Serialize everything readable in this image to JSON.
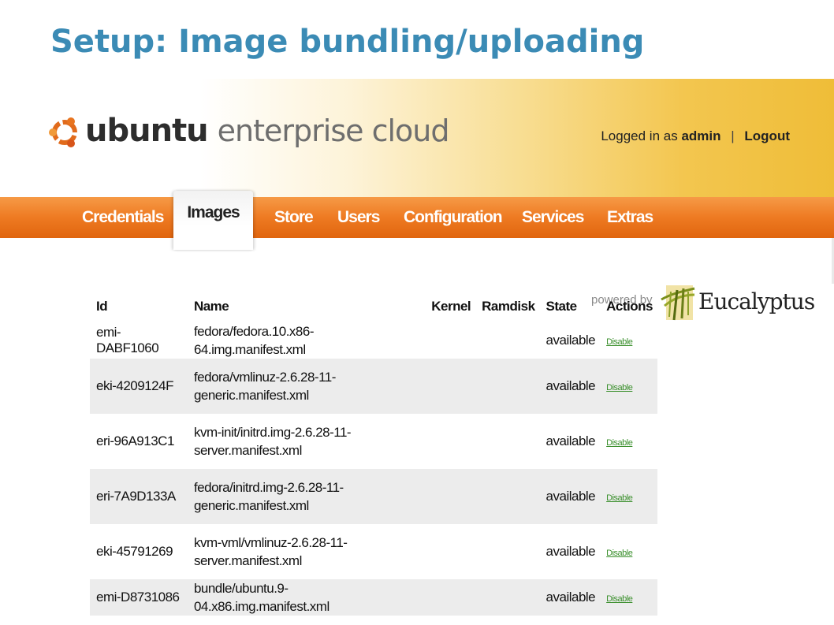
{
  "slide": {
    "title": "Setup: Image bundling/uploading"
  },
  "header": {
    "brand_ubuntu": "ubuntu",
    "brand_rest": "enterprise cloud",
    "login_prefix": "Logged in as",
    "login_user": "admin",
    "login_separator": "|",
    "logout_label": "Logout"
  },
  "nav": {
    "items": [
      "Credentials",
      "Images",
      "Store",
      "Users",
      "Configuration",
      "Services",
      "Extras"
    ],
    "active": "Images"
  },
  "powered_by": {
    "text": "powered by",
    "brand": "Eucalyptus"
  },
  "table": {
    "headers": [
      "Id",
      "Name",
      "Kernel",
      "Ramdisk",
      "State",
      "Actions"
    ],
    "rows": [
      {
        "id": "emi-DABF1060",
        "name_line1": "fedora/fedora.10.x86-64.img.manifest.xml",
        "name_line2": "",
        "kernel": "",
        "ramdisk": "",
        "state": "available",
        "action": "Disable"
      },
      {
        "id": "eki-4209124F",
        "name_line1": "fedora/vmlinuz-2.6.28-11-",
        "name_line2": "generic.manifest.xml",
        "kernel": "",
        "ramdisk": "",
        "state": "available",
        "action": "Disable"
      },
      {
        "id": "eri-96A913C1",
        "name_line1": "kvm-init/initrd.img-2.6.28-11-",
        "name_line2": "server.manifest.xml",
        "kernel": "",
        "ramdisk": "",
        "state": "available",
        "action": "Disable"
      },
      {
        "id": "eri-7A9D133A",
        "name_line1": "fedora/initrd.img-2.6.28-11-",
        "name_line2": "generic.manifest.xml",
        "kernel": "",
        "ramdisk": "",
        "state": "available",
        "action": "Disable"
      },
      {
        "id": "eki-45791269",
        "name_line1": "kvm-vml/vmlinuz-2.6.28-11-",
        "name_line2": "server.manifest.xml",
        "kernel": "",
        "ramdisk": "",
        "state": "available",
        "action": "Disable"
      },
      {
        "id": "emi-D8731086",
        "name_line1": "bundle/ubuntu.9-04.x86.img.manifest.xml",
        "name_line2": "",
        "kernel": "",
        "ramdisk": "",
        "state": "available",
        "action": "Disable"
      }
    ]
  },
  "colors": {
    "title_blue": "#3b8bb5",
    "nav_orange": "#ee7a22",
    "header_gold": "#efbd38",
    "link_green": "#3a8f2c",
    "row_shade": "#ececec"
  },
  "icons": {
    "brand_logo": "ubuntu-circle-of-friends-icon",
    "euc_logo": "eucalyptus-leaves-icon"
  }
}
